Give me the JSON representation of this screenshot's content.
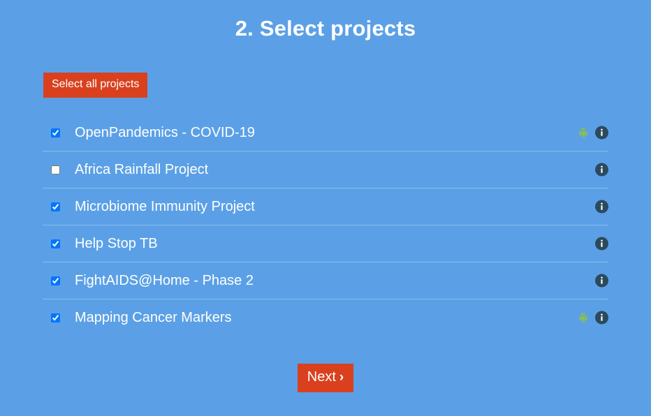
{
  "page": {
    "title": "2. Select projects",
    "background_color": "#5ba0e6",
    "accent_color": "#d9411e",
    "text_color": "#ffffff",
    "divider_color": "#8cbcee"
  },
  "toolbar": {
    "select_all_label": "Select all projects"
  },
  "projects": [
    {
      "label": "OpenPandemics - COVID-19",
      "checked": true,
      "has_android_icon": true,
      "has_info_icon": true
    },
    {
      "label": "Africa Rainfall Project",
      "checked": false,
      "has_android_icon": false,
      "has_info_icon": true
    },
    {
      "label": "Microbiome Immunity Project",
      "checked": true,
      "has_android_icon": false,
      "has_info_icon": true
    },
    {
      "label": "Help Stop TB",
      "checked": true,
      "has_android_icon": false,
      "has_info_icon": true
    },
    {
      "label": "FightAIDS@Home - Phase 2",
      "checked": true,
      "has_android_icon": false,
      "has_info_icon": true
    },
    {
      "label": "Mapping Cancer Markers",
      "checked": true,
      "has_android_icon": true,
      "has_info_icon": true
    }
  ],
  "icons": {
    "android": "android-icon",
    "info": "info-icon",
    "chevron": "chevron-right-icon",
    "android_color": "#8cc04f",
    "info_bg_color": "#2b4a5e"
  },
  "footer": {
    "next_label": "Next",
    "next_chevron": "›"
  }
}
